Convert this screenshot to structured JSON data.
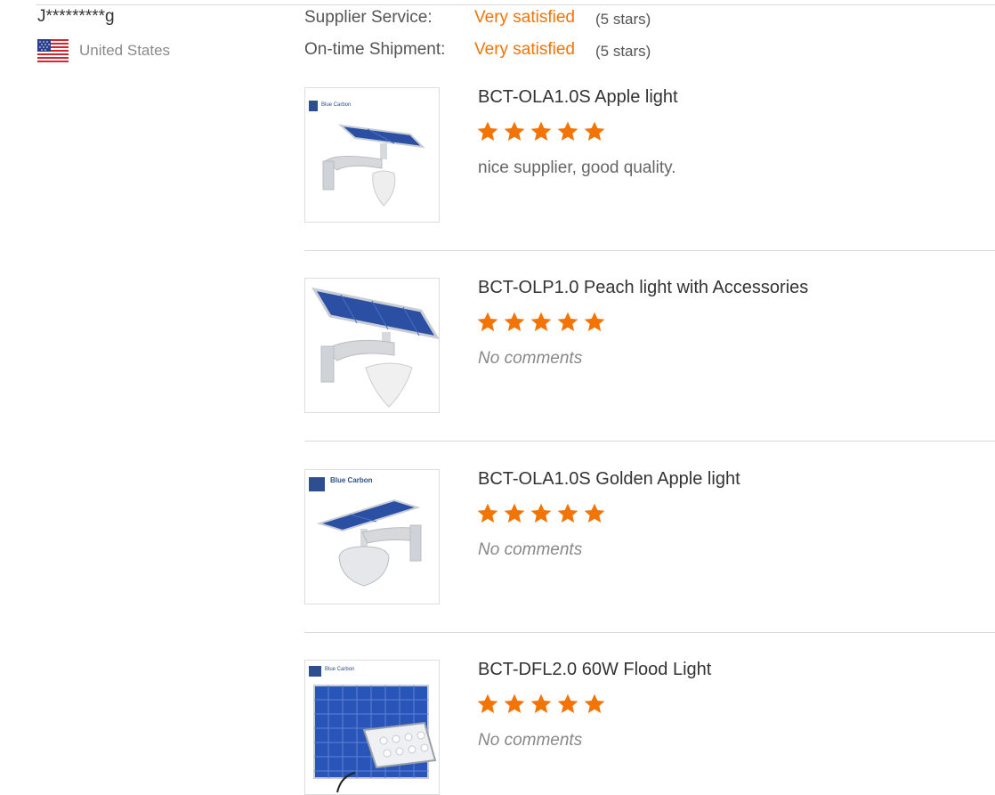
{
  "buyer": {
    "name": "J*********g",
    "country": "United States",
    "flag_icon": "us-flag-icon"
  },
  "ratings": [
    {
      "label": "Supplier Service:",
      "value": "Very satisfied",
      "stars_text": "(5 stars)"
    },
    {
      "label": "On-time Shipment:",
      "value": "Very satisfied",
      "stars_text": "(5 stars)"
    }
  ],
  "colors": {
    "accent": "#f27405",
    "divider": "#d9d9d9",
    "muted": "#8a8a8a"
  },
  "products": [
    {
      "title": "BCT-OLA1.0S Apple light",
      "rating": 5,
      "comment": "nice supplier, good quality.",
      "brand": "Blue Carbon"
    },
    {
      "title": "BCT-OLP1.0 Peach light with Accessories",
      "rating": 5,
      "comment": "No comments",
      "brand": ""
    },
    {
      "title": "BCT-OLA1.0S Golden Apple light",
      "rating": 5,
      "comment": "No comments",
      "brand": "Blue Carbon"
    },
    {
      "title": "BCT-DFL2.0 60W Flood Light",
      "rating": 5,
      "comment": "No comments",
      "brand": "Blue Carbon"
    }
  ]
}
